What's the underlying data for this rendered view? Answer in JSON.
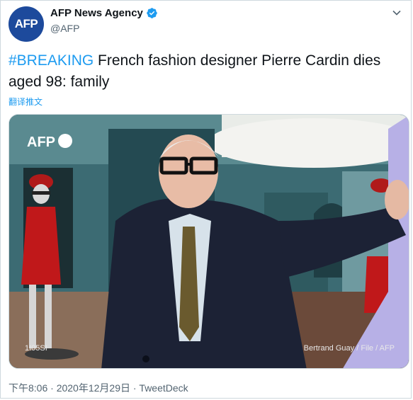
{
  "account": {
    "avatar_text": "AFP",
    "name": "AFP News Agency",
    "handle": "@AFP"
  },
  "tweet": {
    "hashtag": "#BREAKING",
    "text": " French fashion designer Pierre Cardin dies aged 98: family",
    "translate": "翻译推文"
  },
  "photo": {
    "watermark": "AFP",
    "code": "1I05SI",
    "credit": "Bertrand Guay / File / AFP"
  },
  "meta": {
    "time": "下午8:06 · 2020年12月29日 · ",
    "source": "TweetDeck"
  },
  "colors": {
    "link": "#1d9bf0",
    "avatar_bg": "#1d4a9c",
    "verified": "#1d9bf0"
  },
  "icons": [
    "verified-badge-icon",
    "more-options-icon"
  ]
}
